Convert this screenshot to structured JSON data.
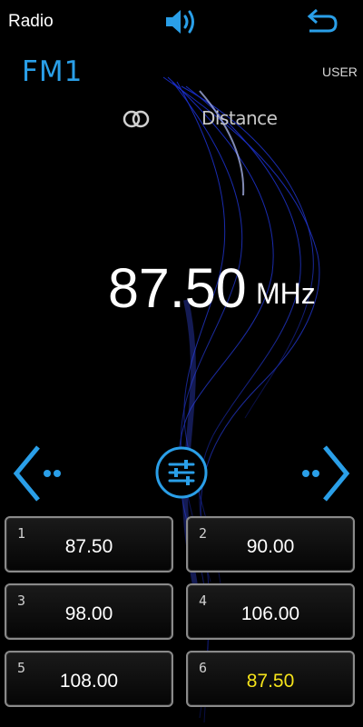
{
  "header": {
    "title": "Radio",
    "volume_icon": "speaker-icon",
    "back_icon": "return-icon"
  },
  "band": "FM1",
  "user_label": "USER",
  "stereo_icon": "stereo-icon",
  "mode_label": "Distance",
  "frequency": {
    "value": "87.50",
    "unit": "MHz"
  },
  "controls": {
    "prev_icon": "seek-prev-icon",
    "eq_icon": "equalizer-icon",
    "next_icon": "seek-next-icon"
  },
  "presets": [
    {
      "num": "1",
      "freq": "87.50"
    },
    {
      "num": "2",
      "freq": "90.00"
    },
    {
      "num": "3",
      "freq": "98.00"
    },
    {
      "num": "4",
      "freq": "106.00"
    },
    {
      "num": "5",
      "freq": "108.00"
    },
    {
      "num": "6",
      "freq": "87.50"
    }
  ],
  "colors": {
    "accent": "#2a9fe8",
    "active_preset": "#f5e31a"
  }
}
